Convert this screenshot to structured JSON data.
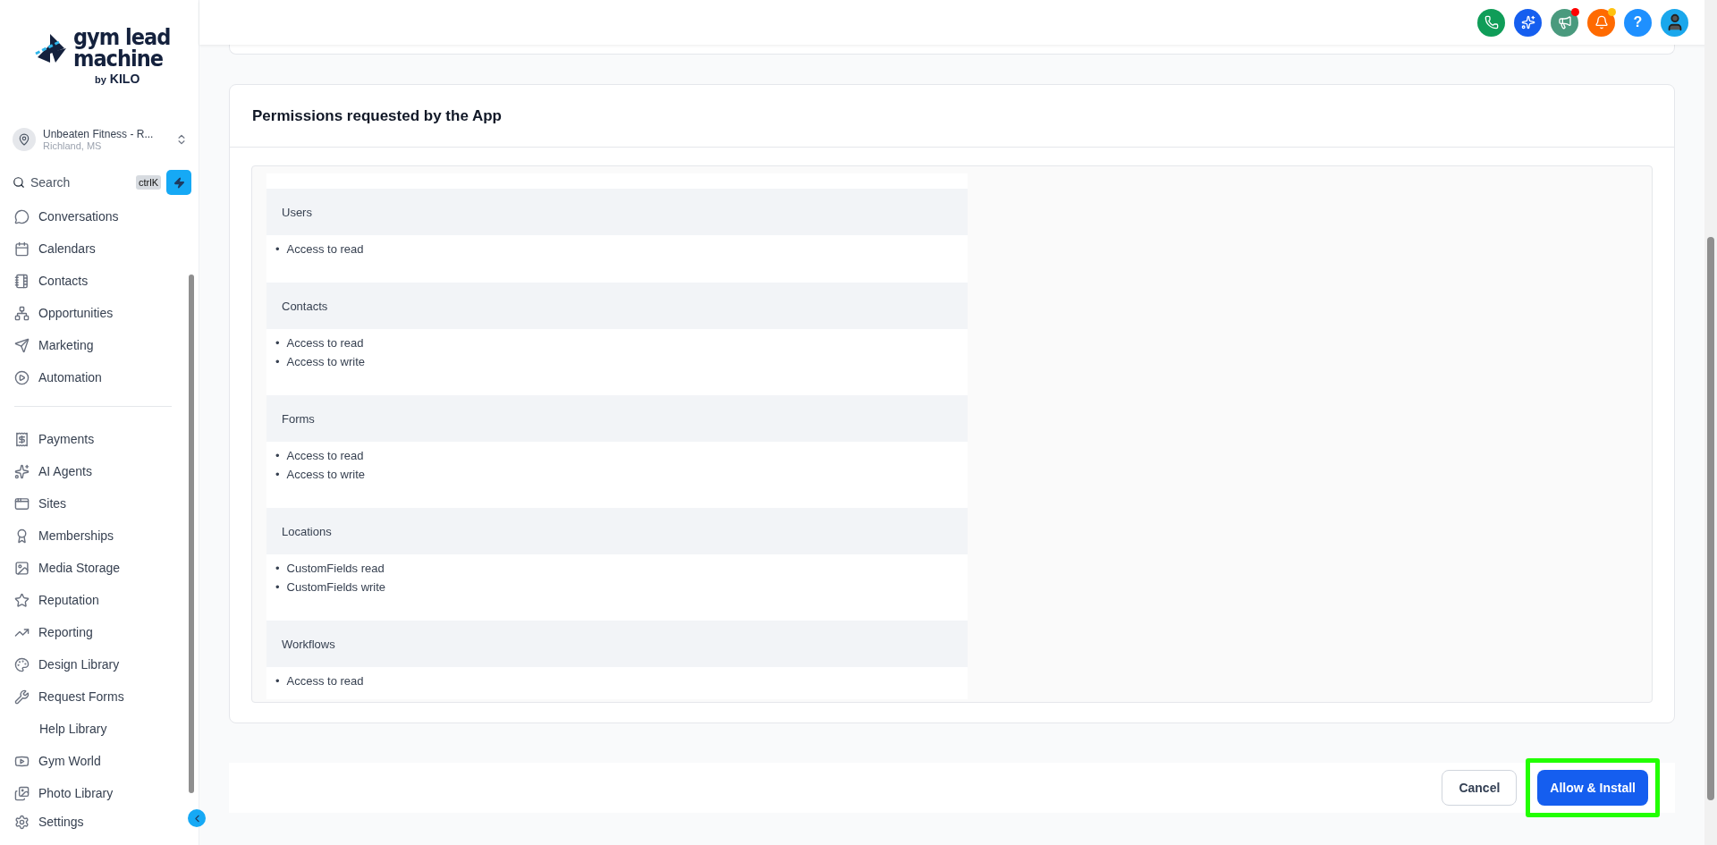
{
  "logo": {
    "line1": "gym lead",
    "line2": "machine",
    "by": "by",
    "brand": "KILO"
  },
  "account": {
    "name": "Unbeaten Fitness - R...",
    "location": "Richland, MS"
  },
  "search": {
    "placeholder": "Search",
    "shortcut": "ctrlK"
  },
  "nav_groups": [
    [
      {
        "label": "Conversations"
      },
      {
        "label": "Calendars"
      },
      {
        "label": "Contacts"
      },
      {
        "label": "Opportunities"
      },
      {
        "label": "Marketing"
      },
      {
        "label": "Automation"
      }
    ],
    [
      {
        "label": "Payments"
      },
      {
        "label": "AI Agents"
      },
      {
        "label": "Sites"
      },
      {
        "label": "Memberships"
      },
      {
        "label": "Media Storage"
      },
      {
        "label": "Reputation"
      },
      {
        "label": "Reporting"
      },
      {
        "label": "Design Library"
      },
      {
        "label": "Request Forms"
      },
      {
        "label": "Help Library"
      },
      {
        "label": "Gym World"
      },
      {
        "label": "Photo Library"
      }
    ]
  ],
  "settings": {
    "label": "Settings"
  },
  "header_buttons": [
    {
      "kind": "phone",
      "color": "#0f9d58"
    },
    {
      "kind": "sparkles",
      "color": "#155eef"
    },
    {
      "kind": "megaphone",
      "color": "#4a9a7e",
      "badge": {
        "color": "#ff0000"
      }
    },
    {
      "kind": "bell",
      "color": "#ff6a00",
      "badge": {
        "color": "#ffc20e"
      }
    },
    {
      "kind": "help",
      "color": "#1e90ff",
      "text": "?"
    },
    {
      "kind": "avatar",
      "color": "#1aa7ec"
    }
  ],
  "permissions": {
    "title": "Permissions requested by the App",
    "bullet": "•",
    "sections": [
      {
        "title": "Users",
        "items": [
          "Access to read"
        ]
      },
      {
        "title": "Contacts",
        "items": [
          "Access to read",
          "Access to write"
        ]
      },
      {
        "title": "Forms",
        "items": [
          "Access to read",
          "Access to write"
        ]
      },
      {
        "title": "Locations",
        "items": [
          "CustomFields read",
          "CustomFields write"
        ]
      },
      {
        "title": "Workflows",
        "items": [
          "Access to read"
        ]
      }
    ]
  },
  "footer": {
    "cancel": "Cancel",
    "confirm": "Allow & Install",
    "confirm_highlighted": true
  }
}
